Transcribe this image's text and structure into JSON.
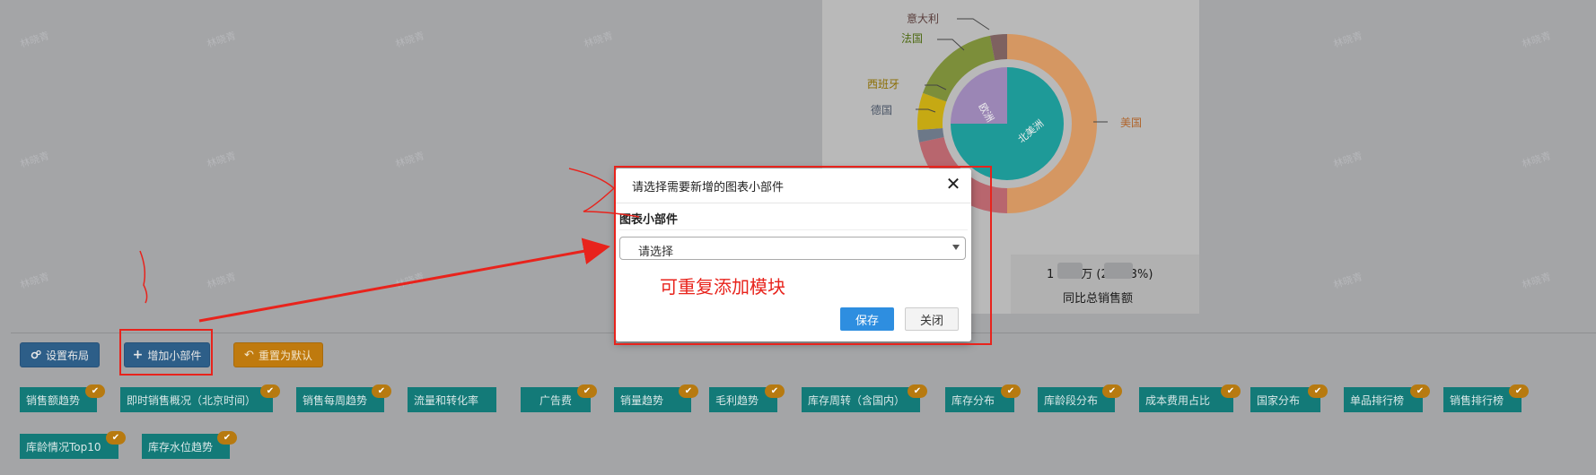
{
  "watermark": "林晓青",
  "chart": {
    "labels": {
      "italy": "意大利",
      "france": "法国",
      "spain": "西班牙",
      "germany": "德国",
      "usa": "美国",
      "europe": "欧洲",
      "north_america": "北美洲"
    },
    "colors": {
      "usa": "#d59762",
      "italy": "#7e6160",
      "france": "#7c8e3a",
      "spain": "#c6a913",
      "germany": "#6c7888",
      "other": "#b8666e",
      "europe": "#9b86b5",
      "north_america": "#1e9a98"
    }
  },
  "kpi": {
    "value_left": "1",
    "value_mid": "万 (2",
    "value_right": "3%)",
    "label": "同比总销售额"
  },
  "toolbar": {
    "layout_label": "设置布局",
    "add_widget_label": "增加小部件",
    "reset_label": "重置为默认"
  },
  "widgets": [
    {
      "label": "销售额趋势",
      "checked": true
    },
    {
      "label": "即时销售概况（北京时间）",
      "checked": true
    },
    {
      "label": "销售每周趋势",
      "checked": true
    },
    {
      "label": "流量和转化率",
      "checked": false
    },
    {
      "label": "广告费",
      "checked": true
    },
    {
      "label": "销量趋势",
      "checked": true
    },
    {
      "label": "毛利趋势",
      "checked": true
    },
    {
      "label": "库存周转（含国内）",
      "checked": true
    },
    {
      "label": "库存分布",
      "checked": true
    },
    {
      "label": "库龄段分布",
      "checked": true
    },
    {
      "label": "成本费用占比",
      "checked": true
    },
    {
      "label": "国家分布",
      "checked": true
    },
    {
      "label": "单品排行榜",
      "checked": true
    },
    {
      "label": "销售排行榜",
      "checked": true
    },
    {
      "label": "库龄情况Top10",
      "checked": true
    },
    {
      "label": "库存水位趋势",
      "checked": true
    }
  ],
  "modal": {
    "title": "请选择需要新增的图表小部件",
    "section_label": "图表小部件",
    "select_value": "请选择",
    "save_label": "保存",
    "close_label": "关闭"
  },
  "annotation": {
    "text": "可重复添加模块"
  }
}
